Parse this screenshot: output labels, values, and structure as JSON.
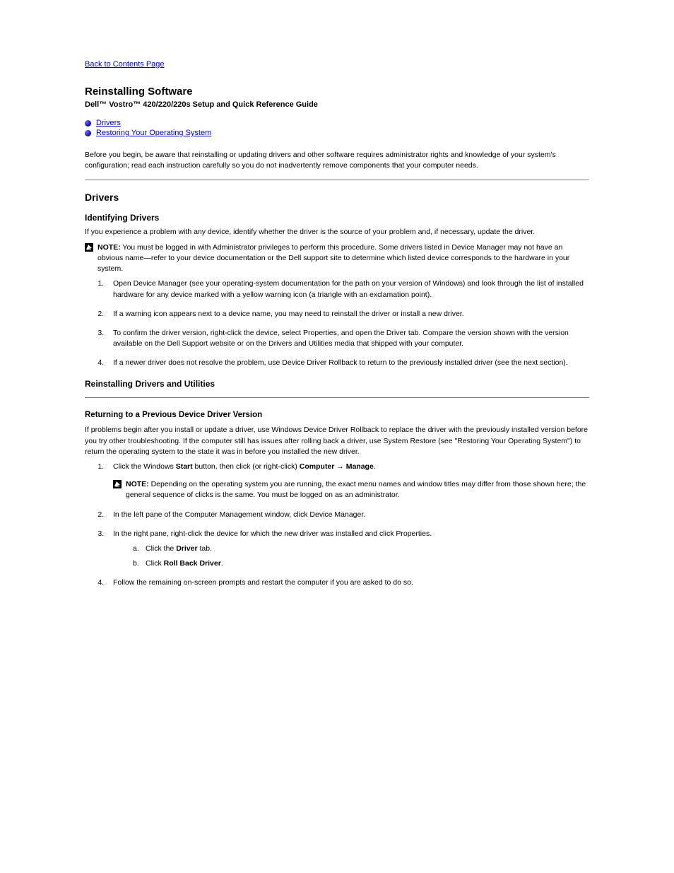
{
  "back": "Back to Contents Page",
  "title": "Reinstalling Software",
  "subtitle": "Dell™ Vostro™ 420/220/220s Setup and Quick Reference Guide",
  "toc": {
    "item1": "Drivers",
    "item2": "Restoring Your Operating System"
  },
  "intro": "Before you begin, be aware that reinstalling or updating drivers and other software requires administrator rights and knowledge of your system's configuration; read each instruction carefully so you do not inadvertently remove components that your computer needs.",
  "sec1": {
    "head": "Drivers",
    "sub1": "Identifying Drivers",
    "p1": "If you experience a problem with any device, identify whether the driver is the source of your problem and, if necessary, update the driver.",
    "noteHead": "NOTE:",
    "noteBody": "You must be logged in with Administrator privileges to perform this procedure. Some drivers listed in Device Manager may not have an obvious name—refer to your device documentation or the Dell support site to determine which listed device corresponds to the hardware in your system.",
    "steps": {
      "s1": "Open Device Manager (see your operating-system documentation for the path on your version of Windows) and look through the list of installed hardware for any device marked with a yellow warning icon (a triangle with an exclamation point).",
      "s2": "If a warning icon appears next to a device name, you may need to reinstall the driver or install a new driver.",
      "s3": "To confirm the driver version, right-click the device, select Properties, and open the Driver tab. Compare the version shown with the version available on the Dell Support website or on the Drivers and Utilities media that shipped with your computer.",
      "s4": "If a newer driver does not resolve the problem, use Device Driver Rollback to return to the previously installed driver (see the next section)."
    },
    "sub2": "Reinstalling Drivers and Utilities",
    "rollback": {
      "head": "Returning to a Previous Device Driver Version",
      "p": "If problems begin after you install or update a driver, use Windows Device Driver Rollback to replace the driver with the previously installed version before you try other troubleshooting. If the computer still has issues after rolling back a driver, use System Restore (see \"Restoring Your Operating System\") to return the operating system to the state it was in before you installed the new driver.",
      "s1_lead": "Click the Windows ",
      "s1_bold1": "Start",
      "s1_mid": " button, then click (or right-click) ",
      "s1_bold2": "Computer",
      "s1_arrow": " → ",
      "s1_bold3": "Manage",
      "s1_tail": ".",
      "noteHead": "NOTE:",
      "noteBody": "Depending on the operating system you are running, the exact menu names and window titles may differ from those shown here; the general sequence of clicks is the same. You must be logged on as an administrator.",
      "s2": "In the left pane of the Computer Management window, click Device Manager.",
      "s3p1": "In the right pane, right-click the device for which the new driver was installed and click Properties.",
      "s3aLead": "Click the ",
      "s3aBold": "Driver",
      "s3aTail": " tab.",
      "s3bLead": "Click ",
      "s3bBold": "Roll Back Driver",
      "s3bTail": ".",
      "s4": "Follow the remaining on-screen prompts and restart the computer if you are asked to do so."
    }
  }
}
